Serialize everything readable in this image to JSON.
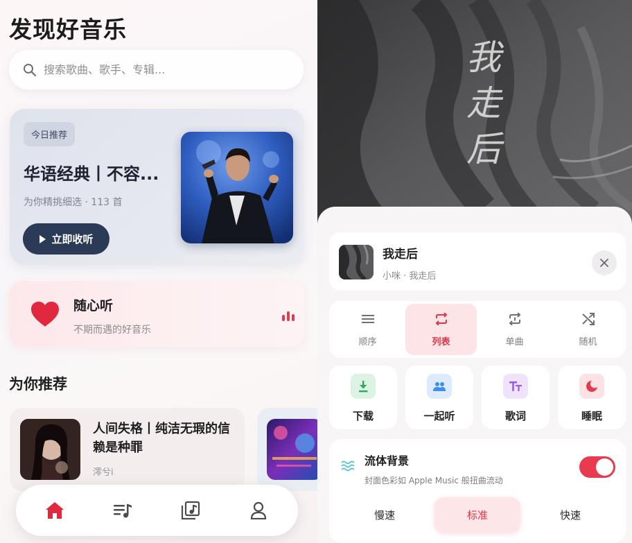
{
  "discover": {
    "title": "发现好音乐",
    "search_placeholder": "搜索歌曲、歌手、专辑...",
    "hero": {
      "tag": "今日推荐",
      "title": "华语经典丨不容...",
      "subtitle": "为你精挑细选 · 113 首",
      "button_label": "立即收听"
    },
    "shuffle": {
      "title": "随心听",
      "subtitle": "不期而遇的好音乐"
    },
    "section_title": "为你推荐",
    "recommendations": [
      {
        "title": "人间失格丨纯洁无瑕的信赖是种罪",
        "artist": "澪兮i"
      }
    ],
    "tabs": [
      "home-icon",
      "playlist-icon",
      "music-library-icon",
      "profile-icon"
    ]
  },
  "player_sheet": {
    "album_art_text": "我走后",
    "now_playing": {
      "title": "我走后",
      "subtitle": "小咪 · 我走后"
    },
    "play_modes": [
      {
        "label": "顺序",
        "icon": "order-icon",
        "active": false
      },
      {
        "label": "列表",
        "icon": "repeat-list-icon",
        "active": true
      },
      {
        "label": "单曲",
        "icon": "repeat-one-icon",
        "active": false
      },
      {
        "label": "随机",
        "icon": "shuffle-icon",
        "active": false
      }
    ],
    "actions": [
      {
        "label": "下载",
        "icon": "download-icon",
        "color": "#36b36c"
      },
      {
        "label": "一起听",
        "icon": "listen-together-icon",
        "color": "#3d8ef0"
      },
      {
        "label": "歌词",
        "icon": "lyrics-icon",
        "color": "#9a5be0"
      },
      {
        "label": "睡眠",
        "icon": "sleep-icon",
        "color": "#e23a4f"
      }
    ],
    "fluid_bg": {
      "title": "流体背景",
      "subtitle": "封面色彩如 Apple Music 般扭曲流动",
      "enabled": true,
      "speeds": [
        "慢速",
        "标准",
        "快速"
      ],
      "selected_speed": "标准"
    }
  },
  "colors": {
    "accent": "#e23a4f",
    "hero_button": "#2b3a57"
  }
}
